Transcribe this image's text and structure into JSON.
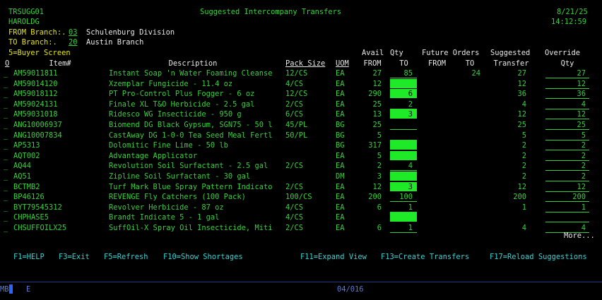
{
  "header": {
    "program": "TRSUGG01",
    "user": "HAROLDG",
    "title": "Suggested Intercompany Transfers",
    "date": "8/21/25",
    "time": "14:12:59",
    "from_label": "FROM Branch:.",
    "from_code": "03",
    "from_name": "Schulenburg Division",
    "to_label": "TO Branch:.",
    "to_code": "20",
    "to_name": "Austin Branch",
    "option_hint": "5=Buyer Screen"
  },
  "columns": {
    "o": "O",
    "item": "Item#",
    "desc": "Description",
    "pack": "Pack Size",
    "uom": "UOM",
    "avail_top": "Avail",
    "avail_bottom": "FROM",
    "qty_top": "Qty",
    "qty_bottom": "TO",
    "future_top": "Future Orders",
    "future_from": "FROM",
    "future_to": "TO",
    "sugg_top": "Suggested",
    "sugg_bottom": "Transfer",
    "over_top": "Override",
    "over_bottom": "Qty"
  },
  "rows": [
    {
      "opt": "_",
      "item": "AM59011811",
      "desc": "Instant Soap 'n Water Foaming Cleanse",
      "pack": "12/CS",
      "uom": "EA",
      "avail": "27",
      "qty": "85",
      "hl": false,
      "ffrom": "",
      "fto": "24",
      "sugg": "27",
      "over": "27"
    },
    {
      "opt": "_",
      "item": "AM59014120",
      "desc": "Xzemplar Fungicide - 11.4 oz",
      "pack": "4/CS",
      "uom": "EA",
      "avail": "12",
      "qty": "",
      "hl": true,
      "ffrom": "",
      "fto": "",
      "sugg": "12",
      "over": "12"
    },
    {
      "opt": "_",
      "item": "AM59018112",
      "desc": "PT Pro-Control Plus Fogger - 6 oz",
      "pack": "12/CS",
      "uom": "EA",
      "avail": "290",
      "qty": "6",
      "hl": true,
      "ffrom": "",
      "fto": "",
      "sugg": "36",
      "over": "36"
    },
    {
      "opt": "_",
      "item": "AM59024131",
      "desc": "Finale XL T&O Herbicide - 2.5 gal",
      "pack": "2/CS",
      "uom": "EA",
      "avail": "25",
      "qty": "2",
      "hl": false,
      "ffrom": "",
      "fto": "",
      "sugg": "4",
      "over": "4"
    },
    {
      "opt": "_",
      "item": "AM59031018",
      "desc": "Ridesco WG Insecticide - 950 g",
      "pack": "6/CS",
      "uom": "EA",
      "avail": "13",
      "qty": "3",
      "hl": true,
      "ffrom": "",
      "fto": "",
      "sugg": "12",
      "over": "12"
    },
    {
      "opt": "_",
      "item": "ANG10006937",
      "desc": "Biomend DG Black Gypsum, SGN75 - 50 l",
      "pack": "45/PL",
      "uom": "BG",
      "avail": "25",
      "qty": "",
      "hl": false,
      "ffrom": "",
      "fto": "",
      "sugg": "25",
      "over": "25"
    },
    {
      "opt": "_",
      "item": "ANG10007834",
      "desc": "CastAway DG 1-0-0 Tea Seed Meal Fertl",
      "pack": "50/PL",
      "uom": "BG",
      "avail": "5",
      "qty": "",
      "hl": false,
      "ffrom": "",
      "fto": "",
      "sugg": "5",
      "over": "5"
    },
    {
      "opt": "_",
      "item": "AP5313",
      "desc": "Dolomitic Fine Lime - 50 lb",
      "pack": "",
      "uom": "BG",
      "avail": "317",
      "qty": "",
      "hl": true,
      "ffrom": "",
      "fto": "",
      "sugg": "2",
      "over": "2"
    },
    {
      "opt": "_",
      "item": "AQT002",
      "desc": "Advantage Applicator",
      "pack": "",
      "uom": "EA",
      "avail": "5",
      "qty": "",
      "hl": true,
      "ffrom": "",
      "fto": "",
      "sugg": "2",
      "over": "2"
    },
    {
      "opt": "_",
      "item": "AQ44",
      "desc": "Revolution Soil Surfactant - 2.5 gal",
      "pack": "2/CS",
      "uom": "EA",
      "avail": "2",
      "qty": "4",
      "hl": false,
      "ffrom": "",
      "fto": "",
      "sugg": "2",
      "over": "2"
    },
    {
      "opt": "_",
      "item": "AQ51",
      "desc": "Zipline Soil Surfactant - 30 gal",
      "pack": "",
      "uom": "DM",
      "avail": "3",
      "qty": "",
      "hl": true,
      "ffrom": "",
      "fto": "",
      "sugg": "2",
      "over": "2"
    },
    {
      "opt": "_",
      "item": "BCTMB2",
      "desc": "Turf Mark Blue Spray Pattern Indicato",
      "pack": "2/CS",
      "uom": "EA",
      "avail": "12",
      "qty": "3",
      "hl": true,
      "ffrom": "",
      "fto": "",
      "sugg": "12",
      "over": "12"
    },
    {
      "opt": "_",
      "item": "BP46126",
      "desc": "REVENGE Fly Catchers (100 Pack)",
      "pack": "100/CS",
      "uom": "EA",
      "avail": "200",
      "qty": "100",
      "hl": false,
      "ffrom": "",
      "fto": "",
      "sugg": "200",
      "over": "200"
    },
    {
      "opt": "_",
      "item": "BYT79545312",
      "desc": "Revolver Herbicide - 87 oz",
      "pack": "4/CS",
      "uom": "EA",
      "avail": "6",
      "qty": "1",
      "hl": false,
      "ffrom": "",
      "fto": "",
      "sugg": "1",
      "over": "1"
    },
    {
      "opt": "_",
      "item": "CHPHASE5",
      "desc": "Brandt Indicate 5 - 1 gal",
      "pack": "4/CS",
      "uom": "EA",
      "avail": "",
      "qty": "",
      "hl": true,
      "ffrom": "",
      "fto": "",
      "sugg": "",
      "over": ""
    },
    {
      "opt": "_",
      "item": "CHSUFFOILX25",
      "desc": "SuffOil-X Spray Oil Insecticide, Miti",
      "pack": "2/CS",
      "uom": "EA",
      "avail": "6",
      "qty": "1",
      "hl": false,
      "ffrom": "",
      "fto": "",
      "sugg": "4",
      "over": "4"
    }
  ],
  "more": "More...",
  "fkeys": {
    "f1": "F1=HELP",
    "f3": "F3=Exit",
    "f5": "F5=Refresh",
    "f10": "F10=Show Shortages",
    "f11": "F11=Expand View",
    "f13": "F13=Create Transfers",
    "f17": "F17=Reload Suggestions"
  },
  "status": {
    "mode": "MB",
    "indicator": "E",
    "cursor_pos": "04/016"
  },
  "colors": {
    "green": "#35d13a",
    "highlight": "#1eea27",
    "white": "#e8e8e8",
    "yellow": "#e6e600",
    "cursor": "#2a63ff"
  }
}
